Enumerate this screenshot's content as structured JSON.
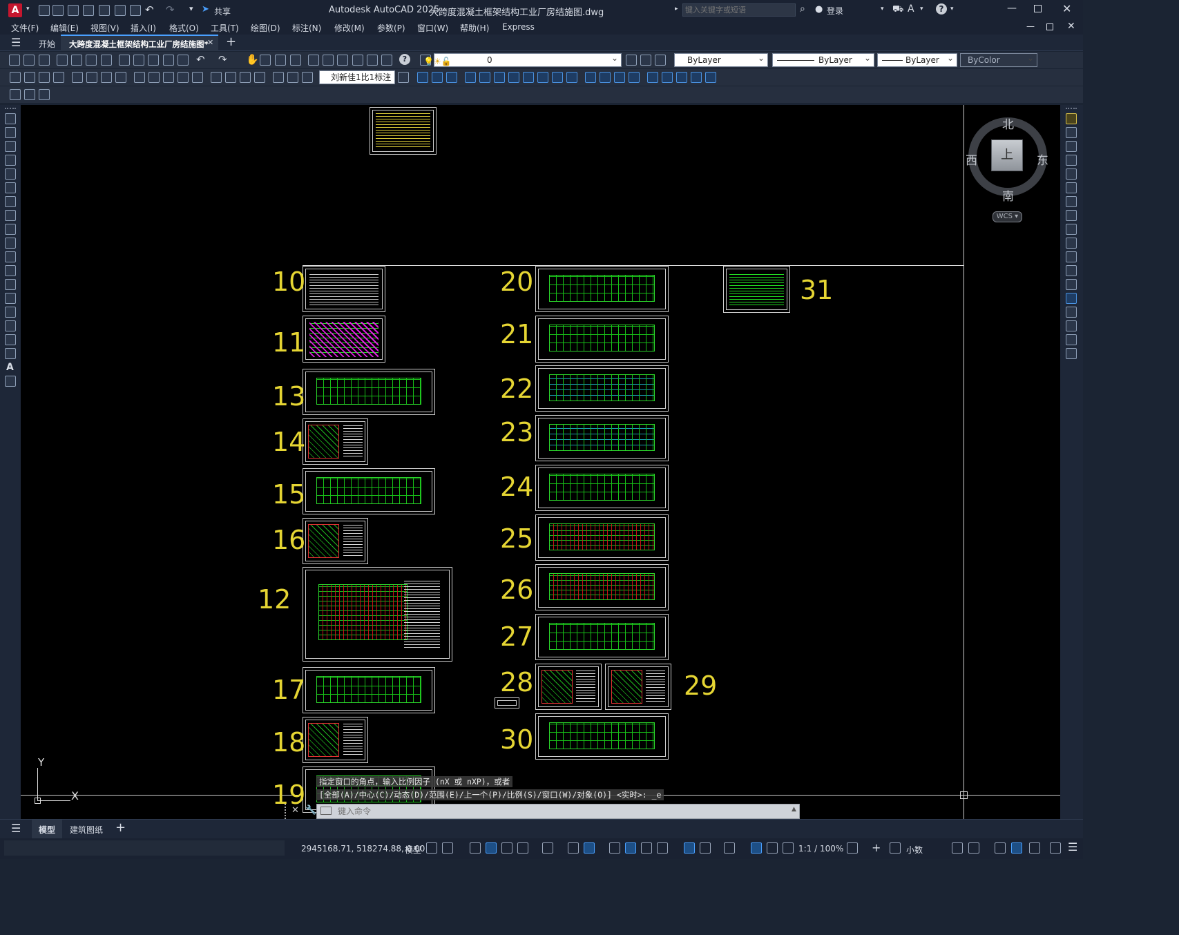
{
  "titlebar": {
    "app_title": "Autodesk AutoCAD 2025",
    "file_title": "大跨度混凝土框架结构工业厂房结施图.dwg",
    "share": "共享",
    "search_placeholder": "键入关键字或短语",
    "login": "登录",
    "logo": "A"
  },
  "menu": [
    "文件(F)",
    "编辑(E)",
    "视图(V)",
    "插入(I)",
    "格式(O)",
    "工具(T)",
    "绘图(D)",
    "标注(N)",
    "修改(M)",
    "参数(P)",
    "窗口(W)",
    "帮助(H)",
    "Express"
  ],
  "tabs": {
    "start": "开始",
    "active": "大跨度混凝土框架结构工业厂房结施图*",
    "add": "+"
  },
  "layer": {
    "current": "0"
  },
  "properties": {
    "color": "ByLayer",
    "linetype": "ByLayer",
    "lineweight": "ByLayer",
    "plotstyle": "ByColor"
  },
  "dimstyle": "刘新佳1比1标注",
  "viewcube": {
    "north": "北",
    "south": "南",
    "east": "东",
    "west": "西",
    "top": "上",
    "wcs": "WCS"
  },
  "ucs": {
    "x": "X",
    "y": "Y"
  },
  "sheet_numbers": [
    "10",
    "11",
    "13",
    "14",
    "15",
    "16",
    "12",
    "17",
    "18",
    "19",
    "20",
    "21",
    "22",
    "23",
    "24",
    "25",
    "26",
    "27",
    "28",
    "29",
    "30",
    "31"
  ],
  "command": {
    "history1": "指定窗口的角点，输入比例因子 (nX 或 nXP)，或者",
    "history2": "[全部(A)/中心(C)/动态(D)/范围(E)/上一个(P)/比例(S)/窗口(W)/对象(O)] <实时>: _e",
    "placeholder": "键入命令"
  },
  "layout_tabs": {
    "model": "模型",
    "layout1": "建筑图纸",
    "add": "+"
  },
  "status": {
    "coords": "2945168.71, 518274.88, 0.00",
    "model": "模型",
    "scale": "1:1 / 100%",
    "units": "小数"
  }
}
